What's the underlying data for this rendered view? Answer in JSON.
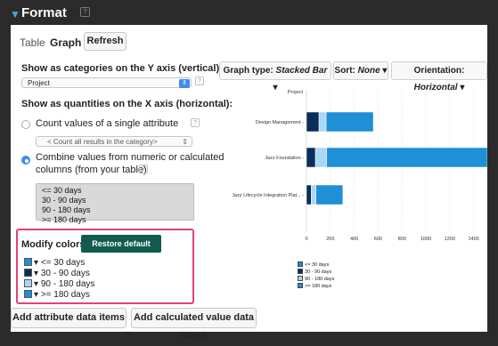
{
  "header": {
    "title": "Format",
    "help": "?"
  },
  "tabs": [
    {
      "label": "Table"
    },
    {
      "label": "Graph"
    }
  ],
  "refresh_label": "Refresh",
  "y_axis": {
    "label": "Show as categories on the Y axis (vertical):",
    "value": "Project"
  },
  "x_axis": {
    "label": "Show as quantities on the X axis (horizontal):",
    "option1": "Count values of a single attribute",
    "option1_select": "< Count all results in the category>",
    "option2_line1": "Combine values from numeric or calculated",
    "option2_line2": "columns (from your table)",
    "columns": [
      "<= 30 days",
      "30 - 90 days",
      "90 - 180 days",
      ">= 180 days"
    ]
  },
  "colors": {
    "label": "Modify colors:",
    "restore_label": "Restore default colors",
    "items": [
      {
        "label": "<= 30 days",
        "color": "#1f8fd6"
      },
      {
        "label": "30 - 90 days",
        "color": "#0b2d5a"
      },
      {
        "label": "90 - 180 days",
        "color": "#a9d8f5"
      },
      {
        "label": ">= 180 days",
        "color": "#1f8fd6"
      }
    ],
    "caret": "▾"
  },
  "buttons": {
    "add_attr": "Add attribute data items",
    "add_calc": "Add calculated value data items"
  },
  "graph_controls": {
    "type_prefix": "Graph type: ",
    "type_value": "Stacked Bar",
    "sort_prefix": "Sort: ",
    "sort_value": "None",
    "orient_prefix": "Orientation: ",
    "orient_value": "Horizontal"
  },
  "chart_data": {
    "type": "bar",
    "orientation": "horizontal",
    "stacked": true,
    "ylabel": "Project",
    "categories": [
      "Design Management",
      "Jazz Foundation",
      "Jazz Lifecycle Integration Plat..."
    ],
    "series": [
      {
        "name": "<= 30 days",
        "color": "#1f8fd6",
        "values": [
          0,
          0,
          0
        ]
      },
      {
        "name": "30 - 90 days",
        "color": "#0b2d5a",
        "values": [
          105,
          75,
          40
        ]
      },
      {
        "name": "90 - 180 days",
        "color": "#a9d8f5",
        "values": [
          60,
          95,
          40
        ]
      },
      {
        "name": ">= 180 days",
        "color": "#1f8fd6",
        "values": [
          395,
          1345,
          225
        ]
      }
    ],
    "xlim": [
      0,
      1500
    ],
    "xticks": [
      "0",
      "200",
      "400",
      "600",
      "800",
      "1000",
      "1200",
      "1400"
    ],
    "grid": true,
    "legend_position": "bottom-left"
  }
}
